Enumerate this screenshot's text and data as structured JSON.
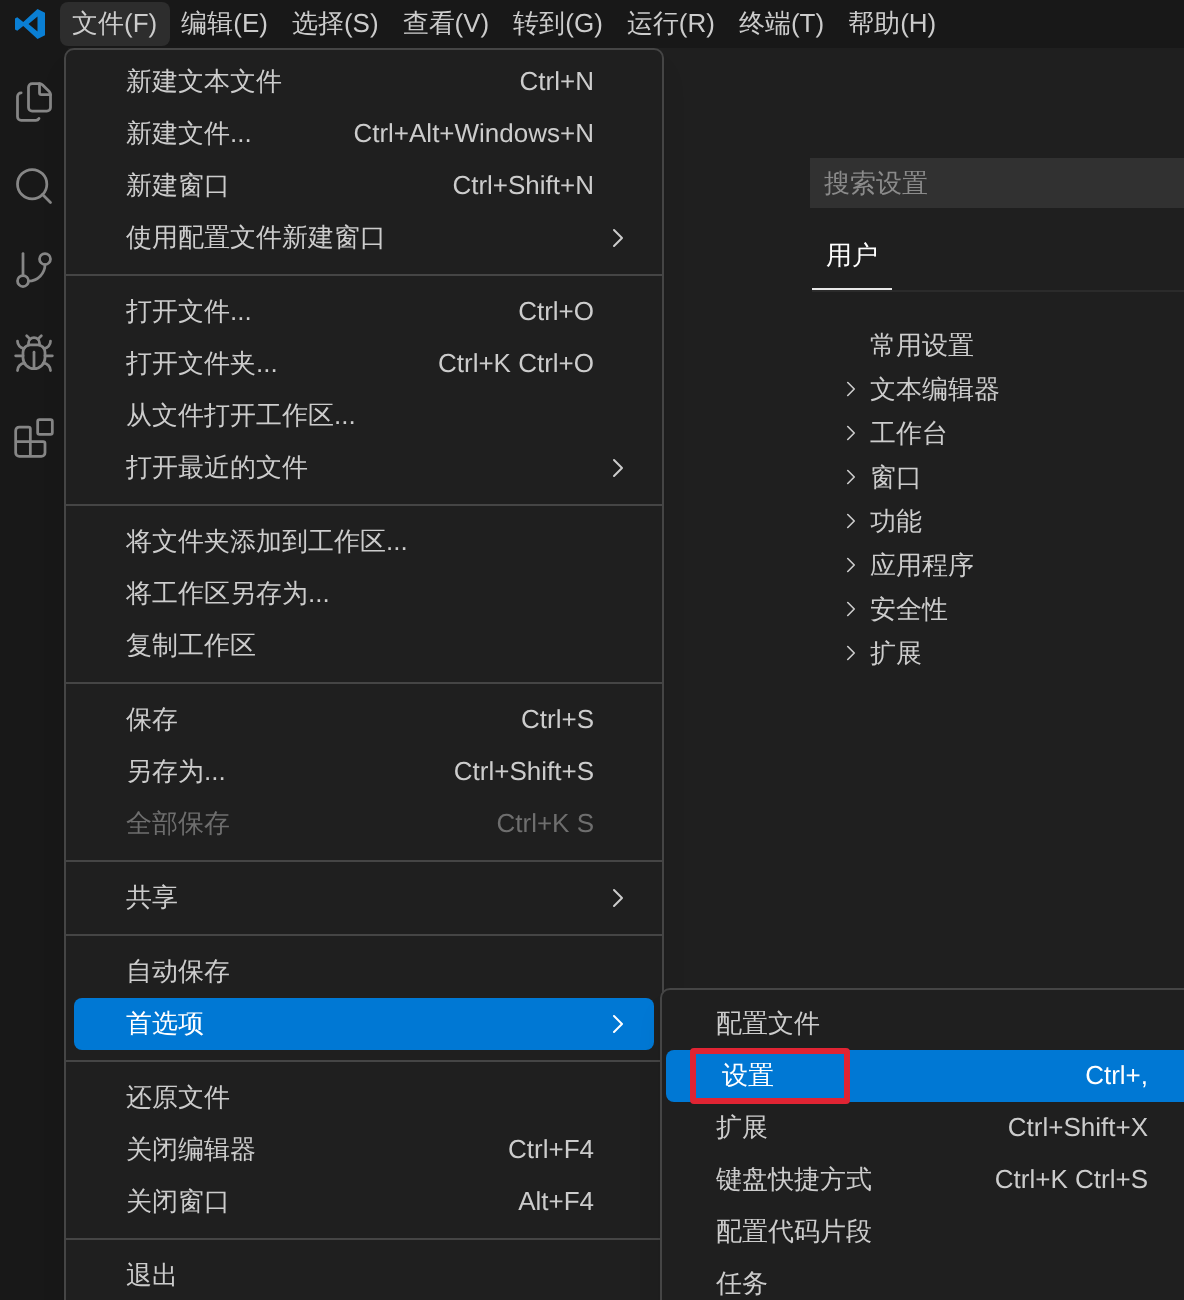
{
  "menubar": [
    {
      "label": "文件(F)",
      "selected": true
    },
    {
      "label": "编辑(E)",
      "selected": false
    },
    {
      "label": "选择(S)",
      "selected": false
    },
    {
      "label": "查看(V)",
      "selected": false
    },
    {
      "label": "转到(G)",
      "selected": false
    },
    {
      "label": "运行(R)",
      "selected": false
    },
    {
      "label": "终端(T)",
      "selected": false
    },
    {
      "label": "帮助(H)",
      "selected": false
    }
  ],
  "settings": {
    "search": {
      "placeholder": "搜索设置"
    },
    "tabs": [
      {
        "label": "用户",
        "selected": true
      }
    ],
    "tree": [
      {
        "label": "常用设置",
        "expandable": false
      },
      {
        "label": "文本编辑器",
        "expandable": true
      },
      {
        "label": "工作台",
        "expandable": true
      },
      {
        "label": "窗口",
        "expandable": true
      },
      {
        "label": "功能",
        "expandable": true
      },
      {
        "label": "应用程序",
        "expandable": true
      },
      {
        "label": "安全性",
        "expandable": true
      },
      {
        "label": "扩展",
        "expandable": true
      }
    ]
  },
  "file_menu": {
    "groups": [
      [
        {
          "label": "新建文本文件",
          "shortcut": "Ctrl+N",
          "has_submenu": false,
          "disabled": false,
          "selected": false
        },
        {
          "label": "新建文件...",
          "shortcut": "Ctrl+Alt+Windows+N",
          "has_submenu": false,
          "disabled": false,
          "selected": false
        },
        {
          "label": "新建窗口",
          "shortcut": "Ctrl+Shift+N",
          "has_submenu": false,
          "disabled": false,
          "selected": false
        },
        {
          "label": "使用配置文件新建窗口",
          "has_submenu": true,
          "disabled": false,
          "selected": false
        }
      ],
      [
        {
          "label": "打开文件...",
          "shortcut": "Ctrl+O",
          "has_submenu": false,
          "disabled": false,
          "selected": false
        },
        {
          "label": "打开文件夹...",
          "shortcut": "Ctrl+K Ctrl+O",
          "has_submenu": false,
          "disabled": false,
          "selected": false
        },
        {
          "label": "从文件打开工作区...",
          "has_submenu": false,
          "disabled": false,
          "selected": false
        },
        {
          "label": "打开最近的文件",
          "has_submenu": true,
          "disabled": false,
          "selected": false
        }
      ],
      [
        {
          "label": "将文件夹添加到工作区...",
          "has_submenu": false,
          "disabled": false,
          "selected": false
        },
        {
          "label": "将工作区另存为...",
          "has_submenu": false,
          "disabled": false,
          "selected": false
        },
        {
          "label": "复制工作区",
          "has_submenu": false,
          "disabled": false,
          "selected": false
        }
      ],
      [
        {
          "label": "保存",
          "shortcut": "Ctrl+S",
          "has_submenu": false,
          "disabled": false,
          "selected": false
        },
        {
          "label": "另存为...",
          "shortcut": "Ctrl+Shift+S",
          "has_submenu": false,
          "disabled": false,
          "selected": false
        },
        {
          "label": "全部保存",
          "shortcut": "Ctrl+K S",
          "has_submenu": false,
          "disabled": true,
          "selected": false
        }
      ],
      [
        {
          "label": "共享",
          "has_submenu": true,
          "disabled": false,
          "selected": false
        }
      ],
      [
        {
          "label": "自动保存",
          "has_submenu": false,
          "disabled": false,
          "selected": false
        },
        {
          "label": "首选项",
          "has_submenu": true,
          "disabled": false,
          "selected": true
        }
      ],
      [
        {
          "label": "还原文件",
          "has_submenu": false,
          "disabled": false,
          "selected": false
        },
        {
          "label": "关闭编辑器",
          "shortcut": "Ctrl+F4",
          "has_submenu": false,
          "disabled": false,
          "selected": false
        },
        {
          "label": "关闭窗口",
          "shortcut": "Alt+F4",
          "has_submenu": false,
          "disabled": false,
          "selected": false
        }
      ],
      [
        {
          "label": "退出",
          "has_submenu": false,
          "disabled": false,
          "selected": false
        }
      ]
    ]
  },
  "preferences_menu": [
    {
      "label": "配置文件",
      "selected": false,
      "annotated": false
    },
    {
      "label": "设置",
      "shortcut": "Ctrl+,",
      "selected": true,
      "annotated": true
    },
    {
      "label": "扩展",
      "shortcut": "Ctrl+Shift+X",
      "selected": false,
      "annotated": false
    },
    {
      "label": "键盘快捷方式",
      "shortcut": "Ctrl+K Ctrl+S",
      "selected": false,
      "annotated": false
    },
    {
      "label": "配置代码片段",
      "selected": false,
      "annotated": false
    },
    {
      "label": "任务",
      "selected": false,
      "annotated": false
    }
  ]
}
